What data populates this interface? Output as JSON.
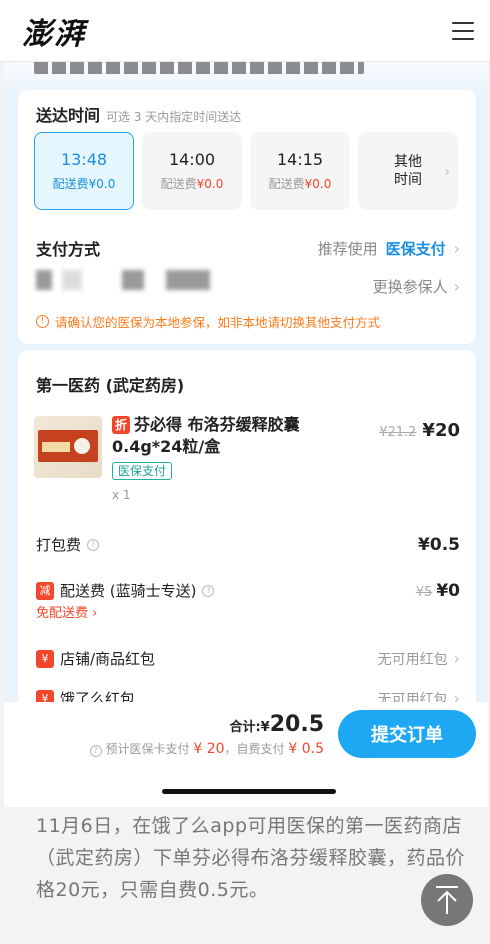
{
  "site": {
    "logo": "澎湃"
  },
  "delivery": {
    "title": "送达时间",
    "hint": "可选 3 天内指定时间送达",
    "slots": [
      {
        "time": "13:48",
        "fee_label": "配送费",
        "fee": "¥0.0"
      },
      {
        "time": "14:00",
        "fee_label": "配送费",
        "fee": "¥0.0"
      },
      {
        "time": "14:15",
        "fee_label": "配送费",
        "fee": "¥0.0"
      }
    ],
    "other_line1": "其他",
    "other_line2": "时间"
  },
  "payment": {
    "title": "支付方式",
    "recommend": "推荐使用",
    "method": "医保支付",
    "switch_insured": "更换参保人",
    "warning": "请确认您的医保为本地参保，如非本地请切换其他支付方式"
  },
  "store": {
    "name": "第一医药 (武定药房)",
    "product": {
      "discount_tag": "折",
      "name": "芬必得 布洛芬缓释胶囊 0.4g*24粒/盒",
      "insurance_tag": "医保支付",
      "qty": "x 1",
      "orig_price": "¥21.2",
      "price": "¥20"
    },
    "packing_fee": {
      "label": "打包费",
      "value": "¥0.5"
    },
    "delivery_fee": {
      "tag": "减",
      "label": "配送费 (蓝骑士专送)",
      "orig": "¥5",
      "value": "¥0",
      "free_link": "免配送费"
    },
    "shop_redpack": {
      "tag": "¥",
      "label": "店铺/商品红包",
      "value": "无可用红包"
    },
    "eleme_redpack": {
      "tag": "¥",
      "label": "饿了么红包",
      "value": "无可用红包"
    }
  },
  "bottom": {
    "total_label": "合计:",
    "currency": "¥",
    "total": "20.5",
    "sub_prefix": "预计医保卡支付",
    "card_amount": "¥ 20",
    "sub_mid": "，自费支付",
    "self_amount": "¥ 0.5",
    "submit": "提交订单"
  },
  "caption": "11月6日，在饿了么app可用医保的第一医药商店（武定药房）下单芬必得布洛芬缓释胶囊，药品价格20元，只需自费0.5元。"
}
